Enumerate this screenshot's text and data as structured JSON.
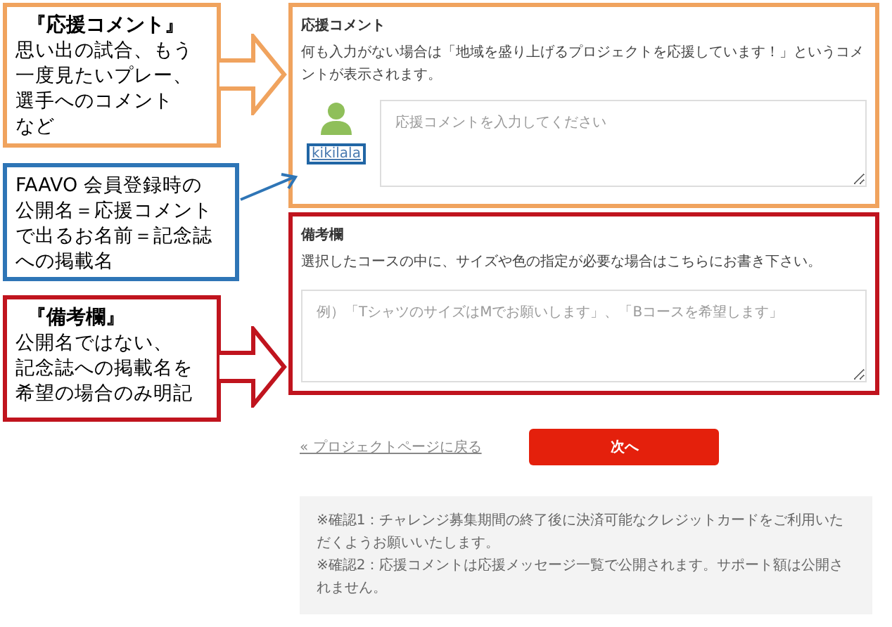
{
  "callouts": [
    {
      "kind": "block-arrow",
      "color": "#f0a35e",
      "title": "『応援コメント』",
      "lines": [
        "思い出の試合、もう",
        "一度見たいプレー、",
        "選手へのコメント",
        "など"
      ]
    },
    {
      "kind": "line-arrow",
      "color": "#2e75b6",
      "lines": [
        "FAAVO 会員登録時の",
        "公開名＝応援コメント",
        "で出るお名前＝記念誌",
        "への掲載名"
      ]
    },
    {
      "kind": "block-arrow",
      "color": "#c0141e",
      "title": "『備考欄』",
      "lines": [
        "公開名ではない、",
        "記念誌への掲載名を",
        "希望の場合のみ明記"
      ]
    }
  ],
  "comment_section": {
    "title": "応援コメント",
    "description": "何も入力がない場合は「地域を盛り上げるプロジェクトを応援しています！」というコメントが表示されます。",
    "user_name": "kikilala",
    "placeholder": "応援コメントを入力してください"
  },
  "remarks_section": {
    "title": "備考欄",
    "description": "選択したコースの中に、サイズや色の指定が必要な場合はこちらにお書き下さい。",
    "placeholder": "例）「TシャツのサイズはMでお願いします」、「Bコースを希望します」"
  },
  "back_link": "« プロジェクトページに戻る",
  "next_button": "次へ",
  "notes": [
    "※確認1：チャレンジ募集期間の終了後に決済可能なクレジットカードをご利用いただくようお願いいたします。",
    "※確認2：応援コメントは応援メッセージ一覧で公開されます。サポート額は公開されません。"
  ]
}
